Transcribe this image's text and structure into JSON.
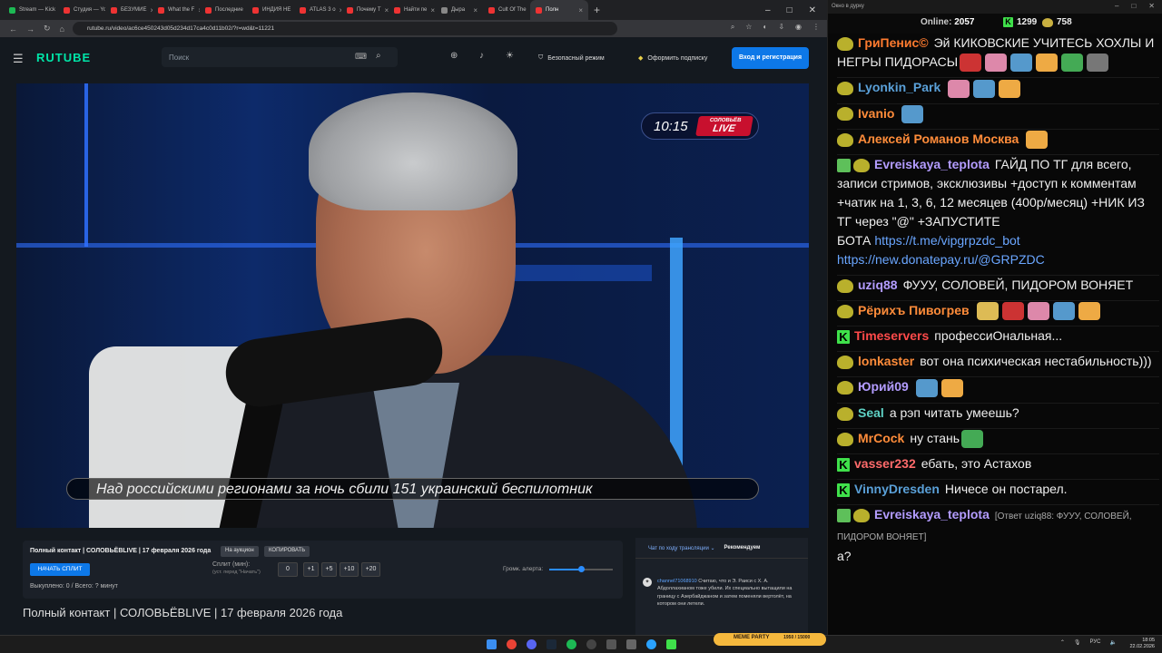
{
  "browser": {
    "tabs": [
      {
        "label": "Stream — Kick",
        "type": "g"
      },
      {
        "label": "Студия — YouTube",
        "type": "r"
      },
      {
        "label": "БЕЗУМИЕ",
        "type": "r"
      },
      {
        "label": "What the F",
        "type": "r"
      },
      {
        "label": "Последние",
        "type": "r"
      },
      {
        "label": "ИНДИЯ НЕ",
        "type": "r"
      },
      {
        "label": "ATLAS 3 о",
        "type": "r"
      },
      {
        "label": "Почему Т",
        "type": "r"
      },
      {
        "label": "Найти пе",
        "type": "r"
      },
      {
        "label": "Дыра",
        "type": "n"
      },
      {
        "label": "Cult Of The",
        "type": "r"
      },
      {
        "label": "Полн",
        "type": "active"
      }
    ],
    "url": "rutube.ru/video/ac6ce450243d05d234d17ca4c0d11b02/?r=wd&t=11221",
    "window_controls": [
      "–",
      "□",
      "✕"
    ]
  },
  "rutube": {
    "logo": "RUTUBE",
    "search_placeholder": "Поиск",
    "safe_mode": "Безопасный режим",
    "subscribe": "Оформить подписку",
    "login": "Вход и регистрация"
  },
  "video": {
    "time": "10:15",
    "channel_badge_top": "СОЛОВЬЁВ",
    "channel_badge_bottom": "LIVE",
    "subtitle": "Над российскими регионами за ночь сбили 151 украинский беспилотник"
  },
  "controls": {
    "title": "Полный контакт | СОЛОВЬЁВLIVE | 17 февраля 2026 года",
    "auction": "На аукцион",
    "copy": "КОПИРОВАТЬ",
    "start_split": "НАЧАТЬ СПЛИТ",
    "split_label": "Сплит (мин):",
    "split_sub": "(уст. перед \"Начать\")",
    "split_value": "0",
    "increments": [
      "+1",
      "+5",
      "+10",
      "+20"
    ],
    "volume_label": "Громк. алерта:",
    "volume_level": 0.5,
    "done": "Выкуплено: 0 / Всего: ? минут"
  },
  "page_title": "Полный контакт | СОЛОВЬЁВLIVE | 17 февраля 2026 года",
  "rutube_chat": {
    "tab_chat": "Чат по ходу трансляции",
    "tab_rec": "Рекомендуем",
    "msg_user": "channel71068910",
    "msg_text": "Считаю, что и Э. Раиси с Х. А. Абдоллахианом тоже убили. Их специально вытащили на границу с Азербайджаном и затем поменяли вертолёт, на котором они летели."
  },
  "taskbar": {
    "meme_party": "MEME PARTY",
    "meme_count": "1950 / 15000",
    "lang": "РУС",
    "time": "18:05",
    "date": "22.02.2026"
  },
  "chat_window": {
    "title": "Окно в дурку",
    "online_label": "Online:",
    "online_count": "2057",
    "kick_count": "1299",
    "twitch_count": "758",
    "colors": {
      "accent_green": "#3fe04a",
      "link": "#6aa6ff"
    },
    "messages": [
      {
        "nick": "ГриПенис©",
        "color": "#ff7b2f",
        "badge": "b",
        "text": "Эй КИКОВСКИЕ УЧИТЕСЬ ХОХЛЫ И НЕГРЫ ПИДОРАСЫ",
        "emotes": 6
      },
      {
        "nick": "Lyonkin_Park",
        "color": "#5aa0d8",
        "badge": "b",
        "text": "",
        "emotes": 3
      },
      {
        "nick": "Ivanio",
        "color": "#ff8c3a",
        "badge": "b",
        "text": "",
        "emotes": 1
      },
      {
        "nick": "Алексей Романов Москва",
        "color": "#ff8c3a",
        "badge": "b",
        "text": "",
        "emotes": 1
      },
      {
        "nick": "Evreiskaya_teplota",
        "color": "#b39cff",
        "badge": "chk",
        "text": "ГАЙД ПО ТГ для всего, записи стримов, эксклюзивы +доступ к комментам +чатик на 1, 3, 6, 12 месяцев (400р/месяц) +НИК ИЗ ТГ через \"@\" +ЗАПУСТИТЕ БОТА",
        "link1": "https://t.me/vipgrpzdc_bot",
        "link2": "https://new.donatepay.ru/@GRPZDC"
      },
      {
        "nick": "uziq88",
        "color": "#b39cff",
        "badge": "b",
        "text": "ФУУУ, СОЛОВЕЙ, ПИДОРОМ ВОНЯЕТ"
      },
      {
        "nick": "Рёрихъ Пивогрев",
        "color": "#ff8c3a",
        "badge": "b",
        "text": "",
        "emotes": 5
      },
      {
        "nick": "Timeservers",
        "color": "#ff4a4a",
        "badge": "k",
        "text": "профессиОнальная..."
      },
      {
        "nick": "lonkaster",
        "color": "#ff8c3a",
        "badge": "b",
        "text": "вот она психическая нестабильность)))"
      },
      {
        "nick": "Юрий09",
        "color": "#b39cff",
        "badge": "b",
        "text": "",
        "emotes": 2
      },
      {
        "nick": "Seal",
        "color": "#5ed1c4",
        "badge": "b",
        "text": "а рэп читать умеешь?"
      },
      {
        "nick": "MrCock",
        "color": "#ff8c3a",
        "badge": "b",
        "text": "ну стань",
        "emotes": 1
      },
      {
        "nick": "vasser232",
        "color": "#ff6b6b",
        "badge": "k",
        "text": "ебать, это Астахов"
      },
      {
        "nick": "VinnyDresden",
        "color": "#5aa0d8",
        "badge": "k",
        "text": "Ничесе он постарел."
      },
      {
        "nick": "Evreiskaya_teplota",
        "color": "#b39cff",
        "badge": "chk",
        "reply": "[Ответ uziq88: ФУУУ, СОЛОВЕЙ, ПИДОРОМ ВОНЯЕТ]",
        "text": "а?"
      }
    ]
  }
}
